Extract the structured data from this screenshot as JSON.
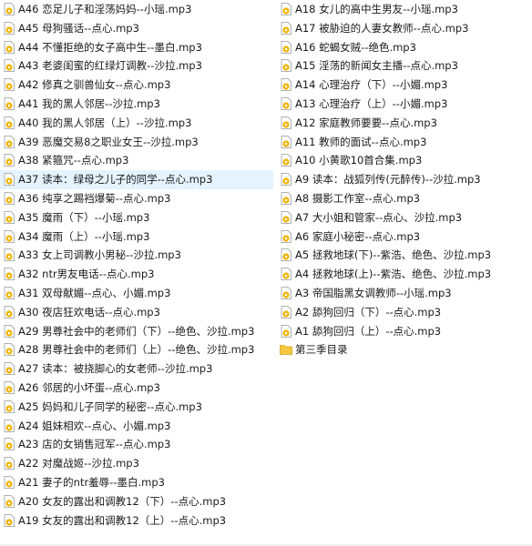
{
  "left_column": [
    {
      "label": "A46 恋足儿子和淫荡妈妈--小瑶.mp3",
      "type": "audio"
    },
    {
      "label": "A45 母狗骚话--点心.mp3",
      "type": "audio"
    },
    {
      "label": "A44 不懂拒绝的女子高中生--墨白.mp3",
      "type": "audio"
    },
    {
      "label": "A43 老婆闺蜜的红绿灯调教--沙拉.mp3",
      "type": "audio"
    },
    {
      "label": "A42 修真之驯兽仙女--点心.mp3",
      "type": "audio"
    },
    {
      "label": "A41 我的黑人邻居--沙拉.mp3",
      "type": "audio"
    },
    {
      "label": "A40 我的黑人邻居（上）--沙拉.mp3",
      "type": "audio"
    },
    {
      "label": "A39 恶魔交易8之职业女王--沙拉.mp3",
      "type": "audio"
    },
    {
      "label": "A38 紧箍咒--点心.mp3",
      "type": "audio"
    },
    {
      "label": "A37 读本：绿母之儿子的同学--点心.mp3",
      "type": "audio",
      "selected": true
    },
    {
      "label": "A36 纯享之踢裆爆菊--点心.mp3",
      "type": "audio"
    },
    {
      "label": "A35 魔雨（下）--小瑶.mp3",
      "type": "audio"
    },
    {
      "label": "A34 魔雨（上）--小瑶.mp3",
      "type": "audio"
    },
    {
      "label": "A33 女上司调教小男秘--沙拉.mp3",
      "type": "audio"
    },
    {
      "label": "A32 ntr男友电话--点心.mp3",
      "type": "audio"
    },
    {
      "label": "A31 双母献媚--点心、小媚.mp3",
      "type": "audio"
    },
    {
      "label": "A30 夜店狂欢电话--点心.mp3",
      "type": "audio"
    },
    {
      "label": "A29 男尊社会中的老师们（下）--绝色、沙拉.mp3",
      "type": "audio"
    },
    {
      "label": "A28 男尊社会中的老师们（上）--绝色、沙拉.mp3",
      "type": "audio"
    },
    {
      "label": "A27 读本：被挠脚心的女老师--沙拉.mp3",
      "type": "audio"
    },
    {
      "label": "A26 邻居的小坏蛋--点心.mp3",
      "type": "audio"
    },
    {
      "label": "A25 妈妈和儿子同学的秘密--点心.mp3",
      "type": "audio"
    },
    {
      "label": "A24 姐妹相欢--点心、小媚.mp3",
      "type": "audio"
    },
    {
      "label": "A23 店的女销售冠军--点心.mp3",
      "type": "audio"
    },
    {
      "label": "A22 对魔战姬--沙拉.mp3",
      "type": "audio"
    },
    {
      "label": "A21 妻子的ntr羞辱--墨白.mp3",
      "type": "audio"
    },
    {
      "label": "A20 女友的露出和调教12（下）--点心.mp3",
      "type": "audio"
    },
    {
      "label": "A19 女友的露出和调教12（上）--点心.mp3",
      "type": "audio"
    }
  ],
  "right_column": [
    {
      "label": "A18 女儿的高中生男友--小瑶.mp3",
      "type": "audio"
    },
    {
      "label": "A17 被胁迫的人妻女教师--点心.mp3",
      "type": "audio"
    },
    {
      "label": "A16 蛇蝎女贼--绝色.mp3",
      "type": "audio"
    },
    {
      "label": "A15 淫荡的新闻女主播--点心.mp3",
      "type": "audio"
    },
    {
      "label": "A14 心理治疗（下）--小媚.mp3",
      "type": "audio"
    },
    {
      "label": "A13 心理治疗（上）--小媚.mp3",
      "type": "audio"
    },
    {
      "label": "A12 家庭教师要要--点心.mp3",
      "type": "audio"
    },
    {
      "label": "A11 教师的面试--点心.mp3",
      "type": "audio"
    },
    {
      "label": "A10 小黄歌10首合集.mp3",
      "type": "audio"
    },
    {
      "label": "A9 读本：战狐列传(元醉传)--沙拉.mp3",
      "type": "audio"
    },
    {
      "label": "A8 摄影工作室--点心.mp3",
      "type": "audio"
    },
    {
      "label": "A7 大小姐和管家--点心、沙拉.mp3",
      "type": "audio"
    },
    {
      "label": "A6 家庭小秘密--点心.mp3",
      "type": "audio"
    },
    {
      "label": "A5 拯救地球(下)--紫浩、绝色、沙拉.mp3",
      "type": "audio"
    },
    {
      "label": "A4 拯救地球(上)--紫浩、绝色、沙拉.mp3",
      "type": "audio"
    },
    {
      "label": "A3 帝国脂黑女调教师--小瑶.mp3",
      "type": "audio"
    },
    {
      "label": "A2 舔狗回归（下）--点心.mp3",
      "type": "audio"
    },
    {
      "label": "A1 舔狗回归（上）--点心.mp3",
      "type": "audio"
    },
    {
      "label": "第三季目录",
      "type": "folder"
    }
  ],
  "colors": {
    "selection": "#e5f3ff",
    "audio_icon": "#f2b400",
    "folder_icon": "#f5c842"
  },
  "icons": {
    "audio": "audio-file-icon",
    "folder": "folder-icon"
  }
}
